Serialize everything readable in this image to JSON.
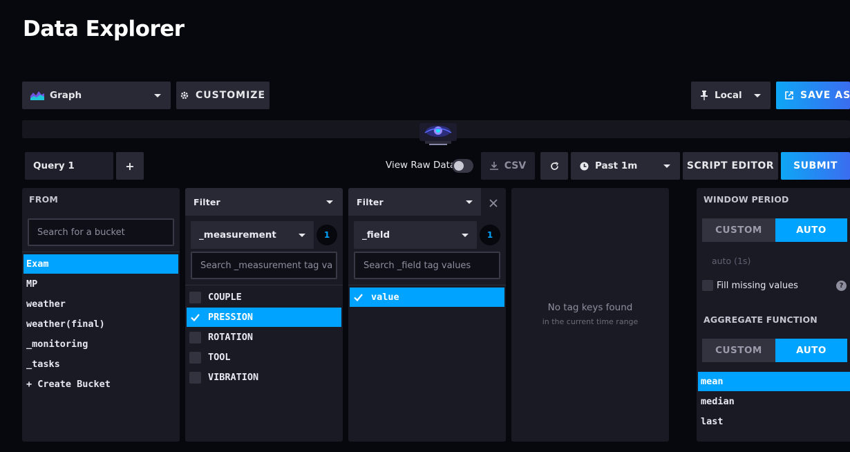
{
  "page_title": "Data Explorer",
  "toolbar": {
    "view_type": "Graph",
    "customize": "CUSTOMIZE",
    "timezone": "Local",
    "save_as": "SAVE AS"
  },
  "query_bar": {
    "query_tab": "Query 1",
    "add_query": "+",
    "view_raw_data": "View Raw Data",
    "csv": "CSV",
    "time_range": "Past 1m",
    "script_editor": "SCRIPT EDITOR",
    "submit": "SUBMIT"
  },
  "from_panel": {
    "heading": "FROM",
    "search_placeholder": "Search for a bucket",
    "buckets": [
      "Exam",
      "MP",
      "weather",
      "weather(final)",
      "_monitoring",
      "_tasks",
      "+ Create Bucket"
    ],
    "selected": "Exam"
  },
  "filter1": {
    "heading": "Filter",
    "key": "_measurement",
    "count": "1",
    "search_placeholder": "Search _measurement tag va",
    "values": [
      {
        "label": "COUPLE",
        "checked": false
      },
      {
        "label": "PRESSION",
        "checked": true
      },
      {
        "label": "ROTATION",
        "checked": false
      },
      {
        "label": "TOOL",
        "checked": false
      },
      {
        "label": "VIBRATION",
        "checked": false
      }
    ]
  },
  "filter2": {
    "heading": "Filter",
    "key": "_field",
    "count": "1",
    "search_placeholder": "Search _field tag values",
    "values": [
      {
        "label": "value",
        "checked": true
      }
    ]
  },
  "empty_panel": {
    "message": "No tag keys found",
    "sub": "in the current time range"
  },
  "aggregate": {
    "window_heading": "WINDOW PERIOD",
    "custom": "CUSTOM",
    "auto": "AUTO",
    "auto_value": "auto (1s)",
    "fill_missing": "Fill missing values",
    "help": "?",
    "function_heading": "AGGREGATE FUNCTION",
    "functions": [
      "mean",
      "median",
      "last"
    ],
    "selected_function": "mean"
  },
  "colors": {
    "accent": "#00a3ff",
    "background": "#07070e",
    "panel": "#1a1a25"
  }
}
